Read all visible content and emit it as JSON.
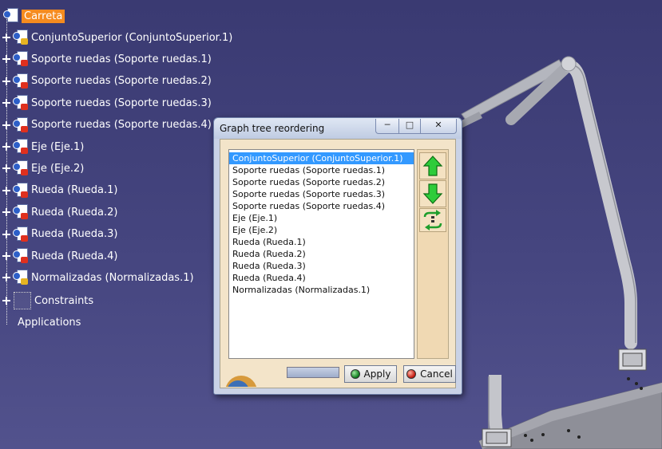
{
  "tree": {
    "root": {
      "label": "Carreta",
      "icon": "product-icon"
    },
    "nodes": [
      {
        "label": "ConjuntoSuperior (ConjuntoSuperior.1)",
        "mark": "yellow"
      },
      {
        "label": "Soporte ruedas (Soporte ruedas.1)",
        "mark": "red"
      },
      {
        "label": "Soporte ruedas (Soporte ruedas.2)",
        "mark": "red"
      },
      {
        "label": "Soporte ruedas (Soporte ruedas.3)",
        "mark": "red"
      },
      {
        "label": "Soporte ruedas (Soporte ruedas.4)",
        "mark": "red"
      },
      {
        "label": "Eje (Eje.1)",
        "mark": "red"
      },
      {
        "label": "Eje (Eje.2)",
        "mark": "red"
      },
      {
        "label": "Rueda (Rueda.1)",
        "mark": "red"
      },
      {
        "label": "Rueda (Rueda.2)",
        "mark": "red"
      },
      {
        "label": "Rueda (Rueda.3)",
        "mark": "red"
      },
      {
        "label": "Rueda (Rueda.4)",
        "mark": "red"
      },
      {
        "label": "Normalizadas (Normalizadas.1)",
        "mark": "yellow"
      }
    ],
    "constraints": "Constraints",
    "applications": "Applications"
  },
  "dialog": {
    "title": "Graph tree reordering",
    "items": [
      "ConjuntoSuperior (ConjuntoSuperior.1)",
      "Soporte ruedas (Soporte ruedas.1)",
      "Soporte ruedas (Soporte ruedas.2)",
      "Soporte ruedas (Soporte ruedas.3)",
      "Soporte ruedas (Soporte ruedas.4)",
      "Eje (Eje.1)",
      "Eje (Eje.2)",
      "Rueda (Rueda.1)",
      "Rueda (Rueda.2)",
      "Rueda (Rueda.3)",
      "Rueda (Rueda.4)",
      "Normalizadas (Normalizadas.1)"
    ],
    "selected_index": 0,
    "apply_label": "Apply",
    "cancel_label": "Cancel",
    "icons": {
      "up": "arrow-up-icon",
      "down": "arrow-down-icon",
      "swap": "swap-icon",
      "minimize": "minimize-icon",
      "maximize": "maximize-icon",
      "close": "close-icon"
    }
  },
  "colors": {
    "background": "#45457f",
    "selection_tree": "#f58b1f",
    "selection_list": "#3399ff",
    "dialog_client": "#f3e4c9"
  }
}
